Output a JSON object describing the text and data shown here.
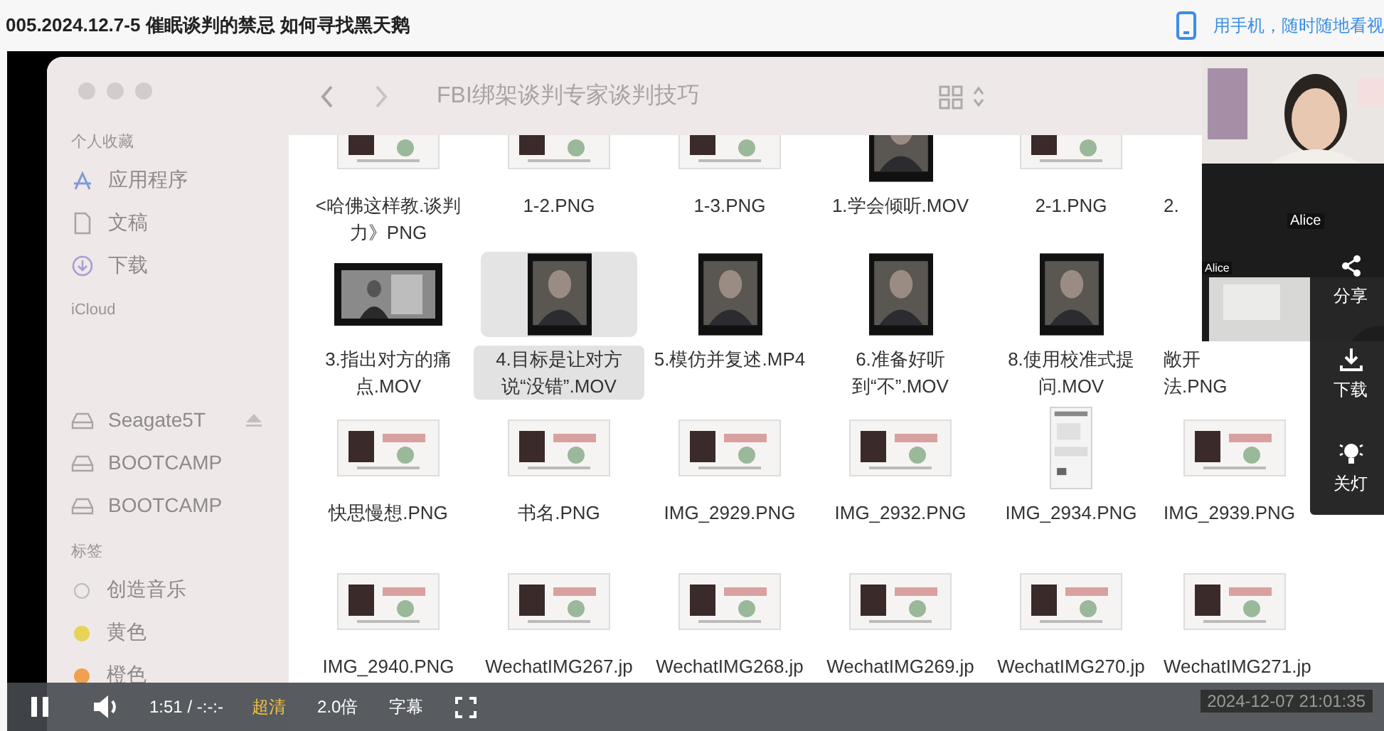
{
  "page": {
    "title": "005.2024.12.7-5 催眠谈判的禁忌 如何寻找黑天鹅",
    "mobile_link": "用手机，随时随地看视"
  },
  "finder": {
    "title": "FBI绑架谈判专家谈判技巧",
    "sidebar": [
      {
        "heading": "个人收藏",
        "items": [
          {
            "kind": "apps",
            "label": "应用程序"
          },
          {
            "kind": "doc",
            "label": "文稿"
          },
          {
            "kind": "download",
            "label": "下载"
          }
        ]
      },
      {
        "heading": "iCloud"
      },
      {
        "items": [
          {
            "kind": "disk",
            "label": "Seagate5T",
            "eject": true
          },
          {
            "kind": "disk",
            "label": "BOOTCAMP",
            "eject": false
          },
          {
            "kind": "disk",
            "label": "BOOTCAMP",
            "eject": false
          }
        ]
      },
      {
        "heading": "标签",
        "items": [
          {
            "kind": "tag",
            "label": "创造音乐"
          },
          {
            "kind": "tag",
            "label": "黄色",
            "color": "#e8d25a"
          },
          {
            "kind": "tag",
            "label": "橙色",
            "color": "#f0a050"
          }
        ]
      }
    ],
    "files": [
      {
        "name": "<哈佛这样教.谈判力》PNG",
        "selected": false
      },
      {
        "name": "1-2.PNG",
        "selected": false
      },
      {
        "name": "1-3.PNG",
        "selected": false
      },
      {
        "name": "1.学会倾听.MOV",
        "kind": "video",
        "selected": false
      },
      {
        "name": "2-1.PNG",
        "selected": false
      },
      {
        "name": "2.",
        "selected": false
      },
      {
        "name": "3.指出对方的痛点.MOV",
        "kind": "video_wide",
        "selected": false
      },
      {
        "name": "4.目标是让对方说“没错”.MOV",
        "kind": "video",
        "selected": true
      },
      {
        "name": "5.模仿并复述.MP4",
        "kind": "video",
        "selected": false
      },
      {
        "name": "6.准备好听到“不”.MOV",
        "kind": "video",
        "selected": false
      },
      {
        "name": "8.使用校准式提问.MOV",
        "kind": "video",
        "selected": false
      },
      {
        "name": "敞开法.PNG",
        "selected": false
      },
      {
        "name": "快思慢想.PNG",
        "selected": false
      },
      {
        "name": "书名.PNG",
        "selected": false
      },
      {
        "name": "IMG_2929.PNG",
        "selected": false
      },
      {
        "name": "IMG_2932.PNG",
        "selected": false
      },
      {
        "name": "IMG_2934.PNG",
        "kind": "image_tall",
        "selected": false
      },
      {
        "name": "IMG_2939.PNG",
        "selected": false
      },
      {
        "name": "IMG_2940.PNG",
        "selected": false
      },
      {
        "name": "WechatIMG267.jp",
        "selected": false
      },
      {
        "name": "WechatIMG268.jp",
        "selected": false
      },
      {
        "name": "WechatIMG269.jp",
        "selected": false
      },
      {
        "name": "WechatIMG270.jp",
        "selected": false
      },
      {
        "name": "WechatIMG271.jp",
        "selected": false
      }
    ]
  },
  "webcam": {
    "labels": [
      "Alice",
      "Alice"
    ]
  },
  "side_panel": [
    {
      "kind": "share",
      "label": "分享"
    },
    {
      "kind": "download",
      "label": "下载"
    },
    {
      "kind": "light",
      "label": "关灯"
    }
  ],
  "player": {
    "playing": true,
    "time": "1:51 / -:-:-",
    "quality": "超清",
    "speed": "2.0倍",
    "subtitles": "字幕"
  },
  "timestamp": "2024-12-07 21:01:35"
}
